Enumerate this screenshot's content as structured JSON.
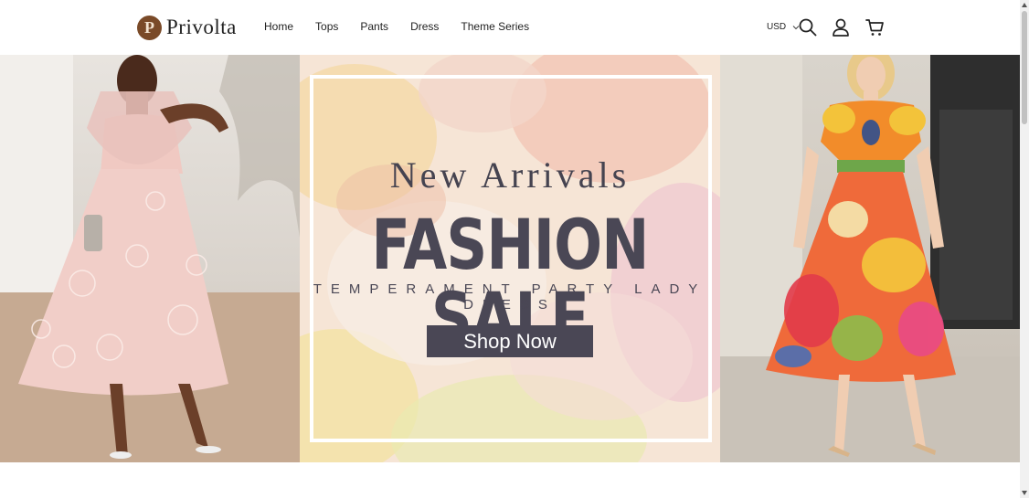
{
  "brand": {
    "name": "Privolta",
    "mark": "P"
  },
  "nav": {
    "items": [
      "Home",
      "Tops",
      "Pants",
      "Dress",
      "Theme Series"
    ]
  },
  "header": {
    "currency": "USD",
    "icons": [
      "search-icon",
      "account-icon",
      "cart-icon"
    ]
  },
  "hero": {
    "heading": "New Arrivals",
    "title": "FASHION SALE",
    "subtitle": "TEMPERAMENT PARTY LADY DRESS",
    "cta": "Shop Now"
  },
  "colors": {
    "accent": "#4a4755",
    "logo": "#7a4a28",
    "background": "#ffffff"
  }
}
